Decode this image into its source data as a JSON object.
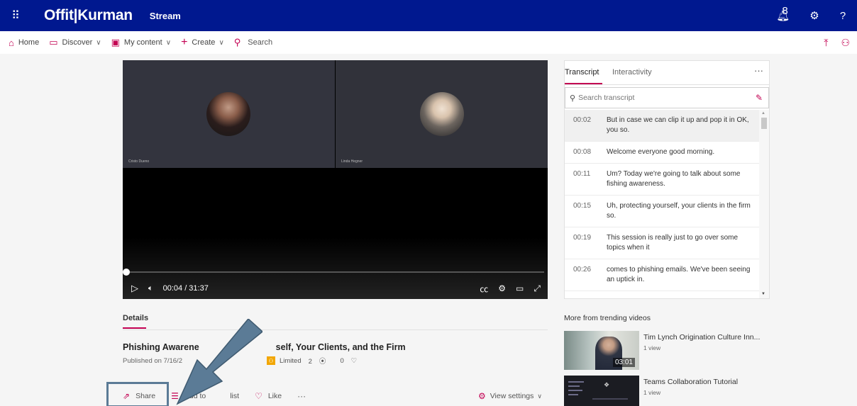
{
  "topbar": {
    "brand": "Offit|Kurman",
    "app": "Stream",
    "notification_count": "8"
  },
  "nav": {
    "home": "Home",
    "discover": "Discover",
    "my_content": "My content",
    "create": "Create",
    "search": "Search"
  },
  "player": {
    "participant_left": "Cristo Dueno",
    "participant_right": "Linda Hegner",
    "time": "00:04 / 31:37",
    "progress_fraction": 0.002
  },
  "details": {
    "tab": "Details",
    "title": "Phishing Awarene",
    "title_tail": "self, Your Clients, and the Firm",
    "published": "Published on 7/16/2",
    "access": "Limited",
    "views": "2",
    "likes": "0"
  },
  "actions": {
    "share": "Share",
    "add_to_list_start": "Add to",
    "add_to_list_end": "list",
    "like": "Like",
    "more": "···",
    "view_settings": "View settings"
  },
  "transcript": {
    "tab_active": "Transcript",
    "tab_other": "Interactivity",
    "search_placeholder": "Search transcript",
    "rows": [
      {
        "ts": "00:02",
        "text": "But in case we can clip it up and pop it in OK, you so."
      },
      {
        "ts": "00:08",
        "text": "Welcome everyone good morning."
      },
      {
        "ts": "00:11",
        "text": "Um? Today we're going to talk about some fishing awareness."
      },
      {
        "ts": "00:15",
        "text": "Uh, protecting yourself, your clients in the firm so."
      },
      {
        "ts": "00:19",
        "text": "This session is really just to go over some topics when it"
      },
      {
        "ts": "00:26",
        "text": "comes to phishing emails. We've been seeing an uptick in."
      }
    ]
  },
  "trending": {
    "title": "More from trending videos",
    "items": [
      {
        "name": "Tim Lynch Origination Culture Inn...",
        "views": "1 view",
        "duration": "03:01"
      },
      {
        "name": "Teams Collaboration Tutorial",
        "views": "1 view"
      }
    ]
  },
  "colors": {
    "topbar": "#00188f",
    "accent": "#c30052",
    "annotation": "#5b7b96"
  }
}
